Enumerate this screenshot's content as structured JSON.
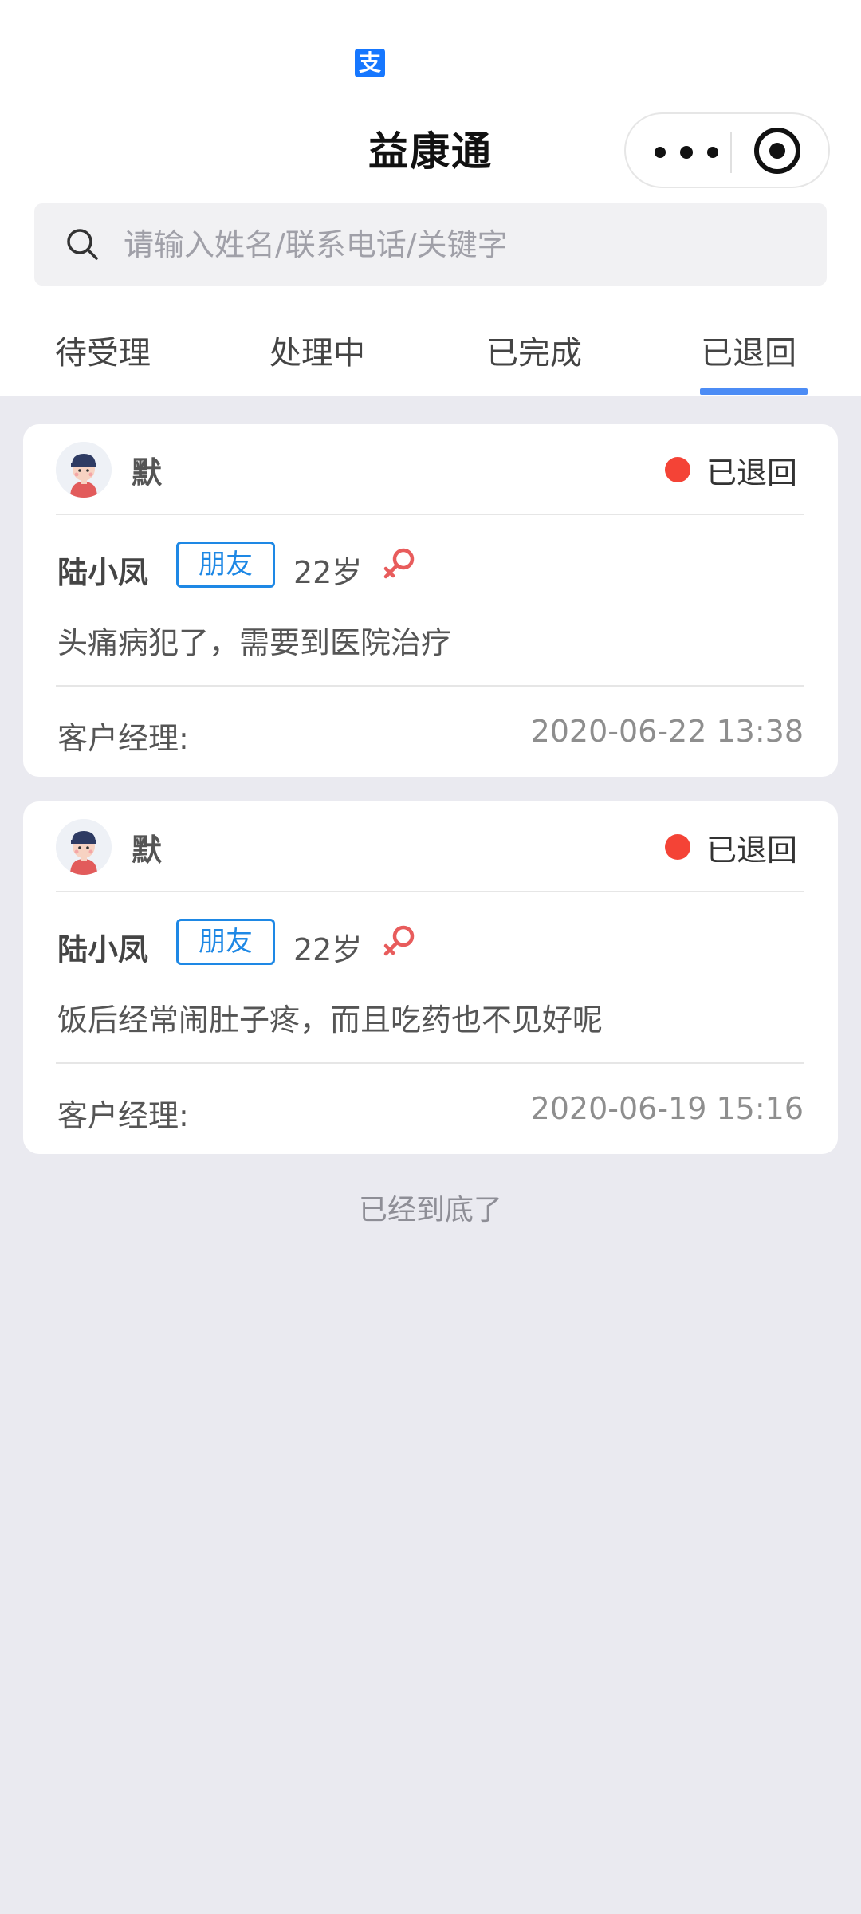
{
  "app_badge": "支",
  "title": "益康通",
  "search": {
    "placeholder": "请输入姓名/联系电话/关键字",
    "value": ""
  },
  "tabs": [
    {
      "label": "待受理",
      "active": false
    },
    {
      "label": "处理中",
      "active": false
    },
    {
      "label": "已完成",
      "active": false
    },
    {
      "label": "已退回",
      "active": true
    }
  ],
  "cards": [
    {
      "sender": "默",
      "status": "已退回",
      "patient_name": "陆小凤",
      "relation": "朋友",
      "age": "22岁",
      "gender_icon": "female-icon",
      "complaint": "头痛病犯了，需要到医院治疗",
      "manager_label": "客户经理:",
      "timestamp": "2020-06-22 13:38"
    },
    {
      "sender": "默",
      "status": "已退回",
      "patient_name": "陆小凤",
      "relation": "朋友",
      "age": "22岁",
      "gender_icon": "female-icon",
      "complaint": "饭后经常闹肚子疼，而且吃药也不见好呢",
      "manager_label": "客户经理:",
      "timestamp": "2020-06-19 15:16"
    }
  ],
  "end_text": "已经到底了",
  "colors": {
    "accent": "#4C8CF5",
    "status_red": "#F44336",
    "tag_blue": "#1E88E5",
    "female_pink": "#E85C5C",
    "page_bg": "#EAEAF0"
  }
}
